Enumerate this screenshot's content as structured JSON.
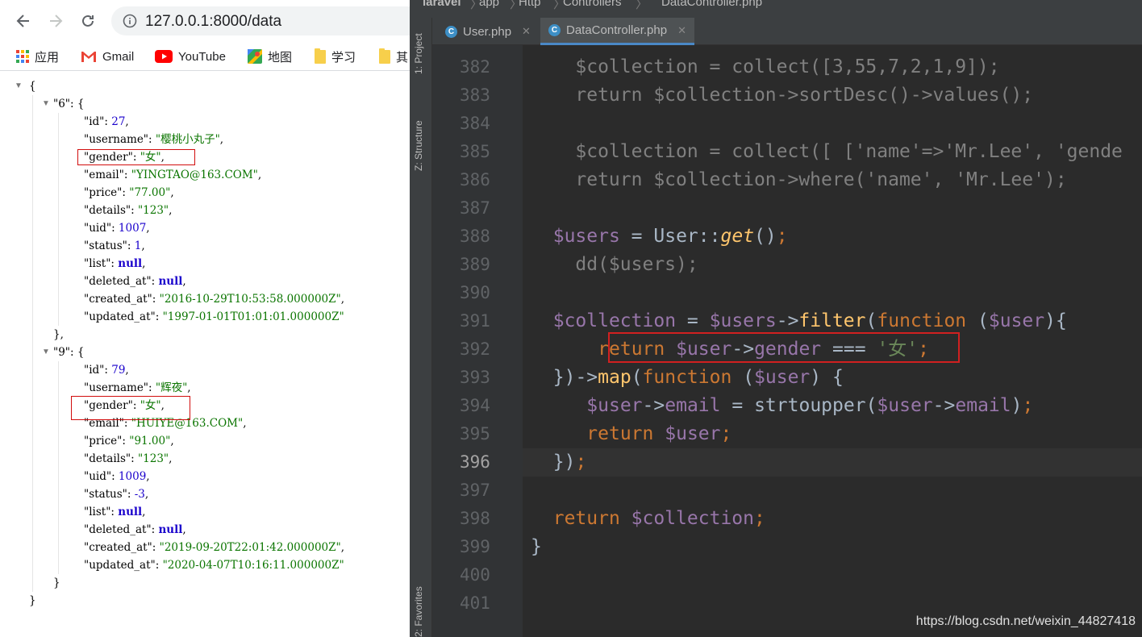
{
  "browser": {
    "url": "127.0.0.1:8000/data",
    "bookmarks": [
      {
        "label": "应用",
        "icon": "apps-grid-icon"
      },
      {
        "label": "Gmail",
        "icon": "gmail-icon"
      },
      {
        "label": "YouTube",
        "icon": "youtube-icon"
      },
      {
        "label": "地图",
        "icon": "maps-icon"
      },
      {
        "label": "学习",
        "icon": "folder-icon"
      },
      {
        "label": "其",
        "icon": "folder-icon"
      }
    ],
    "json_lines": [
      {
        "text": "{"
      },
      {
        "key": "\"6\"",
        "tail": "  {"
      },
      {
        "key": "\"id\"",
        "val": "27",
        "type": "n"
      },
      {
        "key": "\"username\"",
        "val": "\"樱桃小丸子\"",
        "type": "s"
      },
      {
        "key": "\"gender\"",
        "val": "\"女\"",
        "type": "s"
      },
      {
        "key": "\"email\"",
        "val": "\"YINGTAO@163.COM\"",
        "type": "s"
      },
      {
        "key": "\"price\"",
        "val": "\"77.00\"",
        "type": "s"
      },
      {
        "key": "\"details\"",
        "val": "\"123\"",
        "type": "s"
      },
      {
        "key": "\"uid\"",
        "val": "1007",
        "type": "n"
      },
      {
        "key": "\"status\"",
        "val": "1",
        "type": "n"
      },
      {
        "key": "\"list\"",
        "val": "null",
        "type": "nl"
      },
      {
        "key": "\"deleted_at\"",
        "val": "null",
        "type": "nl"
      },
      {
        "key": "\"created_at\"",
        "val": "\"2016-10-29T10:53:58.000000Z\"",
        "type": "s"
      },
      {
        "key": "\"updated_at\"",
        "val": "\"1997-01-01T01:01:01.000000Z\"",
        "type": "s",
        "last": true
      },
      {
        "text": "},"
      },
      {
        "key": "\"9\"",
        "tail": "  {"
      },
      {
        "key": "\"id\"",
        "val": "79",
        "type": "n"
      },
      {
        "key": "\"username\"",
        "val": "\"辉夜\"",
        "type": "s"
      },
      {
        "key": "\"gender\"",
        "val": "\"女\"",
        "type": "s"
      },
      {
        "key": "\"email\"",
        "val": "\"HUIYE@163.COM\"",
        "type": "s"
      },
      {
        "key": "\"price\"",
        "val": "\"91.00\"",
        "type": "s"
      },
      {
        "key": "\"details\"",
        "val": "\"123\"",
        "type": "s"
      },
      {
        "key": "\"uid\"",
        "val": "1009",
        "type": "n"
      },
      {
        "key": "\"status\"",
        "val": "-3",
        "type": "n"
      },
      {
        "key": "\"list\"",
        "val": "null",
        "type": "nl"
      },
      {
        "key": "\"deleted_at\"",
        "val": "null",
        "type": "nl"
      },
      {
        "key": "\"created_at\"",
        "val": "\"2019-09-20T22:01:42.000000Z\"",
        "type": "s"
      },
      {
        "key": "\"updated_at\"",
        "val": "\"2020-04-07T10:16:11.000000Z\"",
        "type": "s",
        "last": true
      },
      {
        "text": "}"
      },
      {
        "text": "}"
      }
    ]
  },
  "ide": {
    "breadcrumbs": [
      "laravel",
      "app",
      "Http",
      "Controllers",
      "DataController.php"
    ],
    "tabs": [
      {
        "label": "User.php",
        "active": false
      },
      {
        "label": "DataController.php",
        "active": true
      }
    ],
    "side_labels": [
      "1: Project",
      "Z: Structure",
      "2: Favorites"
    ],
    "current_line": "396",
    "code_lines": [
      {
        "no": "382",
        "text": "    $collection = collect([3,55,7,2,1,9]);"
      },
      {
        "no": "383",
        "text": "    return $collection->sortDesc()->values();"
      },
      {
        "no": "384",
        "text": ""
      },
      {
        "no": "385",
        "text": "    $collection = collect([ ['name'=>'Mr.Lee', 'gende"
      },
      {
        "no": "386",
        "text": "    return $collection->where('name', 'Mr.Lee');"
      },
      {
        "no": "387",
        "text": ""
      },
      {
        "no": "388",
        "text": "  $users = User::get();"
      },
      {
        "no": "389",
        "text": "    dd($users);"
      },
      {
        "no": "390",
        "text": ""
      },
      {
        "no": "391",
        "text": "  $collection = $users->filter(function ($user){"
      },
      {
        "no": "392",
        "text": "      return $user->gender === '女';"
      },
      {
        "no": "393",
        "text": "  })->map(function ($user) {"
      },
      {
        "no": "394",
        "text": "     $user->email = strtoupper($user->email);"
      },
      {
        "no": "395",
        "text": "     return $user;"
      },
      {
        "no": "396",
        "text": "  });"
      },
      {
        "no": "397",
        "text": ""
      },
      {
        "no": "398",
        "text": "  return $collection;"
      },
      {
        "no": "399",
        "text": "}"
      },
      {
        "no": "400",
        "text": ""
      },
      {
        "no": "401",
        "text": ""
      }
    ]
  },
  "watermark": "https://blog.csdn.net/weixin_44827418"
}
